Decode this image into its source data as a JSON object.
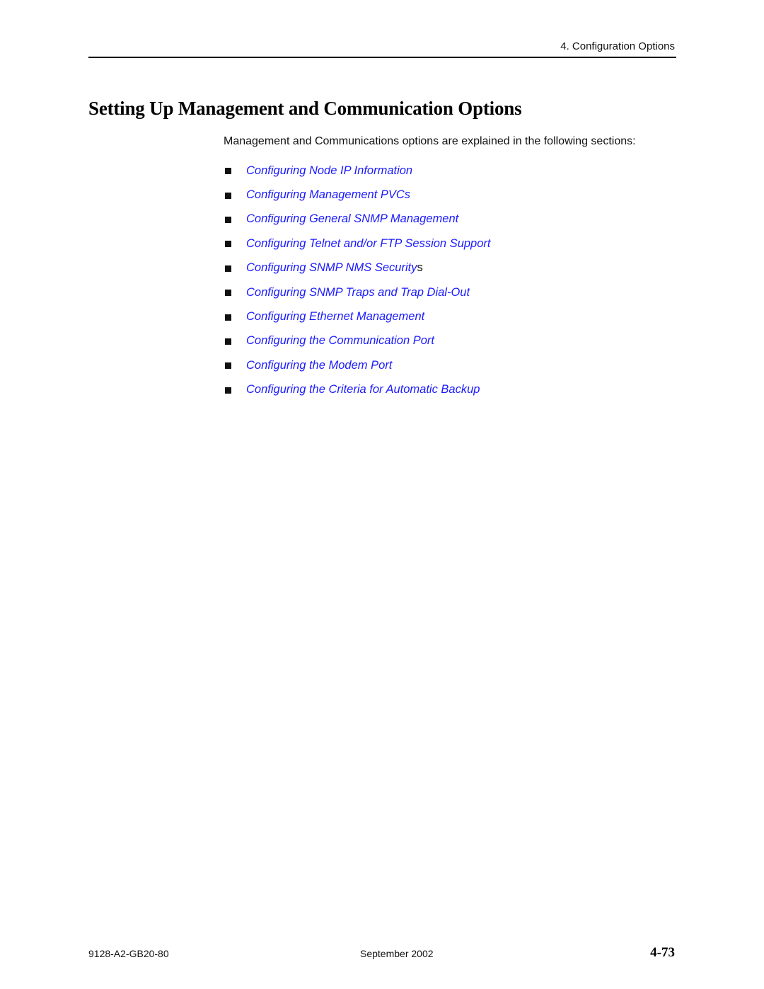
{
  "header": {
    "running_head": "4. Configuration Options"
  },
  "section": {
    "title": "Setting Up Management and Communication Options",
    "intro": "Management and Communications options are explained in the following sections:",
    "links": [
      {
        "label": "Configuring Node IP Information",
        "suffix": ""
      },
      {
        "label": "Configuring Management PVCs",
        "suffix": ""
      },
      {
        "label": "Configuring General SNMP Management",
        "suffix": ""
      },
      {
        "label": "Configuring Telnet and/or FTP Session Support",
        "suffix": ""
      },
      {
        "label": "Configuring SNMP NMS Security",
        "suffix": "s"
      },
      {
        "label": "Configuring SNMP Traps and Trap Dial-Out",
        "suffix": ""
      },
      {
        "label": "Configuring Ethernet Management",
        "suffix": ""
      },
      {
        "label": "Configuring the Communication Port",
        "suffix": ""
      },
      {
        "label": "Configuring the Modem Port",
        "suffix": ""
      },
      {
        "label": "Configuring the Criteria for Automatic Backup",
        "suffix": ""
      }
    ],
    "link_color": "#1a1aff"
  },
  "footer": {
    "doc_number": "9128-A2-GB20-80",
    "date": "September 2002",
    "page_number": "4-73"
  }
}
